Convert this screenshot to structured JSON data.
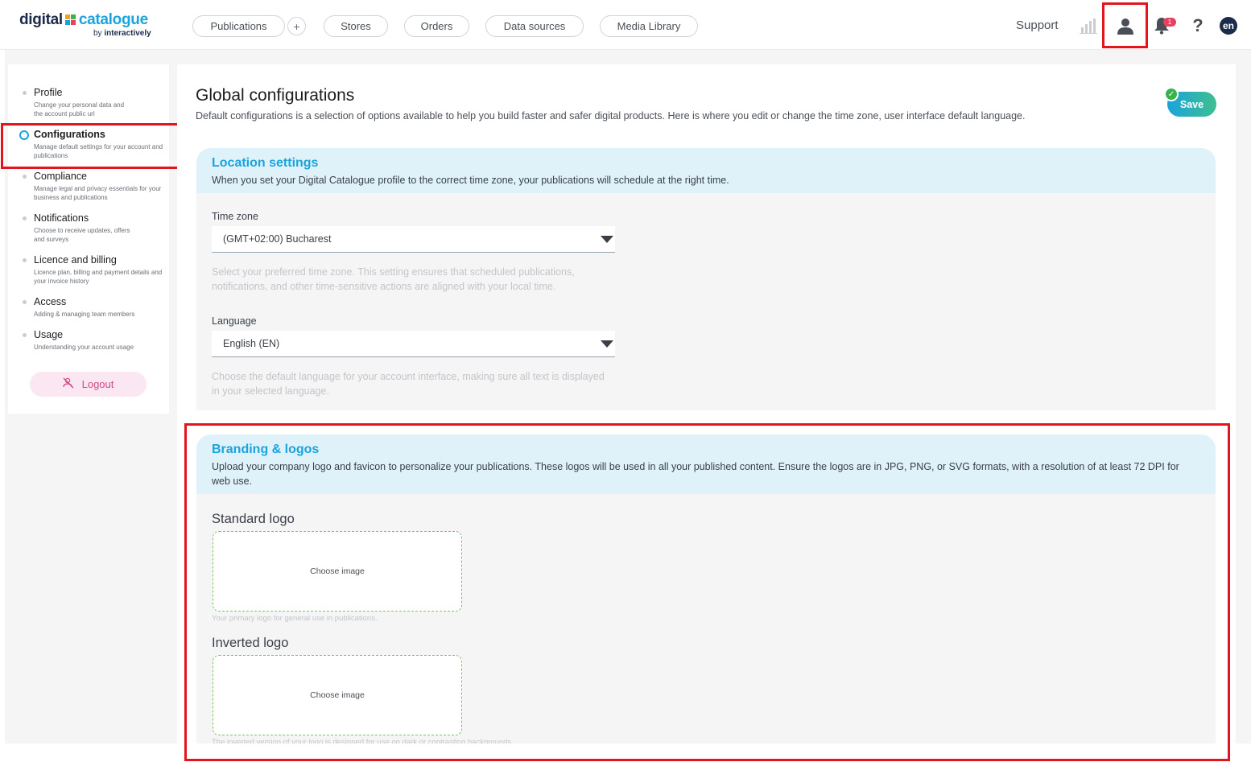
{
  "brand": {
    "word1": "digital",
    "word2": "catalogue",
    "sub_prefix": "by",
    "sub_name": "interactively",
    "colors": {
      "navy": "#1c2b4a",
      "blue": "#1aa3dc",
      "orange": "#f2a21b",
      "green": "#38b24a",
      "pink": "#e8415f"
    }
  },
  "nav": {
    "publications": "Publications",
    "plus": "+",
    "stores": "Stores",
    "orders": "Orders",
    "data_sources": "Data sources",
    "media_library": "Media Library"
  },
  "topright": {
    "support": "Support",
    "analytics_icon": "bar-chart-icon",
    "user_icon": "user-icon",
    "bell_icon": "bell-icon",
    "notification_count": "1",
    "help": "?",
    "language": "en"
  },
  "sidebar": {
    "items": [
      {
        "title": "Profile",
        "desc": "Change your personal data and the account public url",
        "active": false
      },
      {
        "title": "Configurations",
        "desc": "Manage default settings for your account and publications",
        "active": true
      },
      {
        "title": "Compliance",
        "desc": "Manage legal and privacy essentials for your business and publications",
        "active": false
      },
      {
        "title": "Notifications",
        "desc": "Choose to receive updates, offers and surveys",
        "active": false
      },
      {
        "title": "Licence and billing",
        "desc": "Licence plan, billing and payment details and your invoice history",
        "active": false
      },
      {
        "title": "Access",
        "desc": "Adding & managing team members",
        "active": false
      },
      {
        "title": "Usage",
        "desc": "Understanding your account usage",
        "active": false
      }
    ],
    "logout": "Logout",
    "logout_icon": "logout-icon"
  },
  "main": {
    "title": "Global configurations",
    "desc": "Default configurations is a selection of options available to help you build faster and safer digital products. Here is where you edit or change the time zone, user interface default language.",
    "save": "Save",
    "save_check": "✓"
  },
  "location": {
    "title": "Location settings",
    "desc": "When you set your Digital Catalogue profile to the correct time zone, your publications will schedule at the right time.",
    "timezone_label": "Time zone",
    "timezone_value": "(GMT+02:00) Bucharest",
    "timezone_help": "Select your preferred time zone. This setting ensures that scheduled publications, notifications, and other time-sensitive actions are aligned with your local time.",
    "language_label": "Language",
    "language_value": "English (EN)",
    "language_help": "Choose the default language for your account interface, making sure all text is displayed in your selected language."
  },
  "branding": {
    "title": "Branding & logos",
    "desc": "Upload your company logo and favicon to personalize your publications. These logos will be used in all your published content. Ensure the logos are in JPG, PNG, or SVG formats, with a resolution of at least 72 DPI for web use.",
    "standard_title": "Standard logo",
    "standard_choose": "Choose image",
    "standard_help": "Your primary logo for general use in publications.",
    "inverted_title": "Inverted logo",
    "inverted_choose": "Choose image",
    "inverted_help": "The inverted version of your logo is designed for use on dark or contrasting backgrounds."
  }
}
